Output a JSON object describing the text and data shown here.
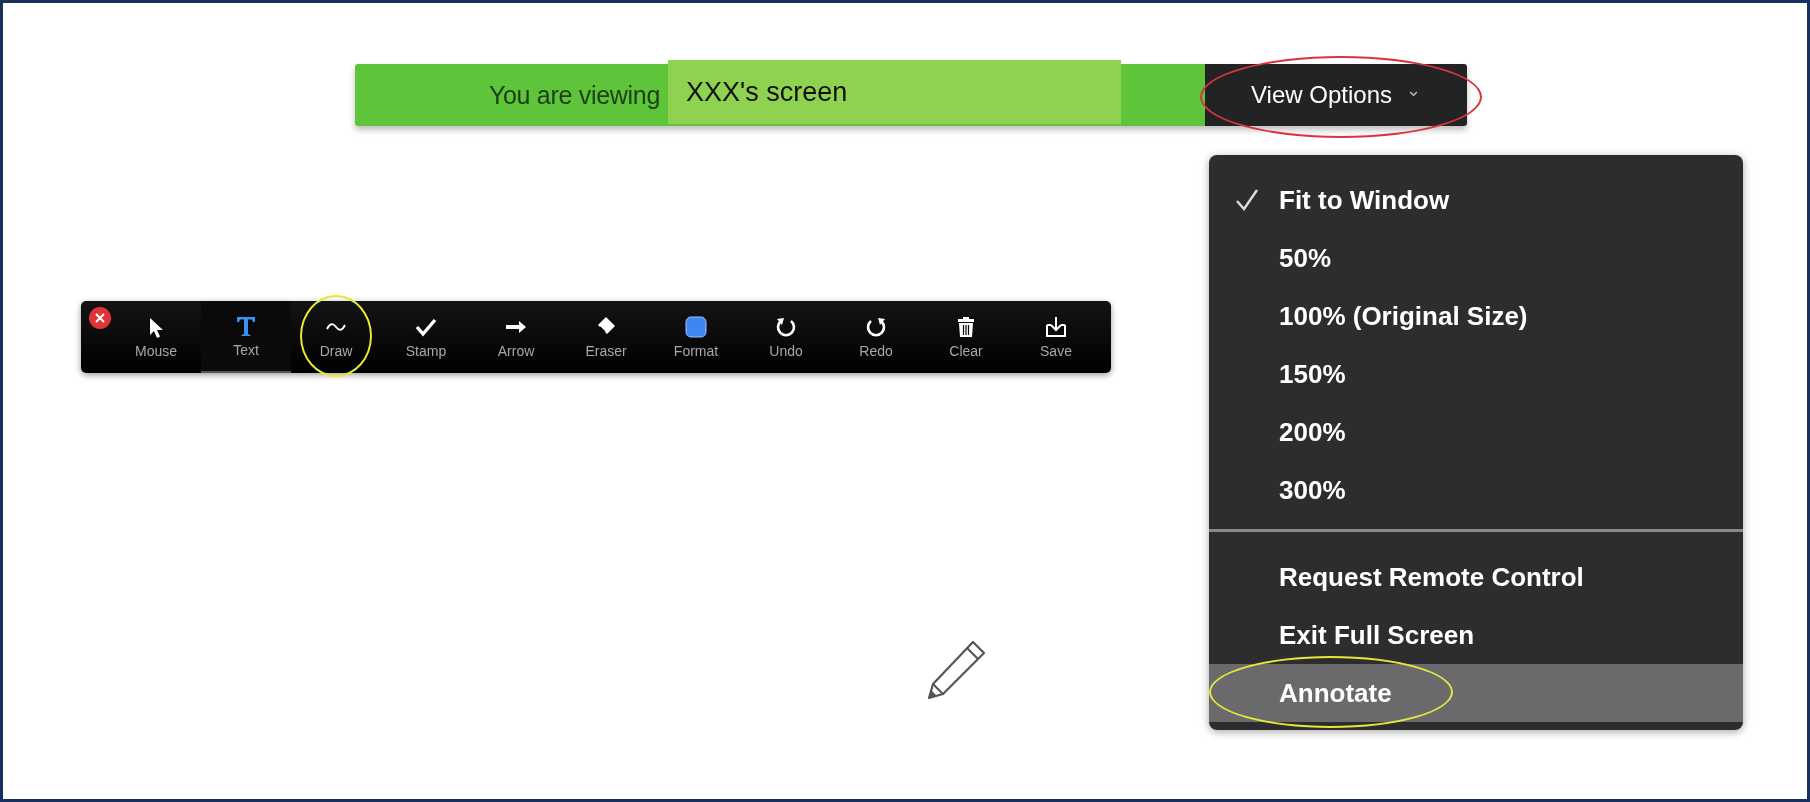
{
  "banner": {
    "prefix": "You are viewing",
    "name": "XXX's screen",
    "button": {
      "label": "View Options",
      "caret": "⌄",
      "circled": true
    }
  },
  "view_menu": {
    "groups": [
      {
        "items": [
          {
            "label": "Fit to Window",
            "checked": true,
            "highlighted": false,
            "circled": false
          },
          {
            "label": "50%",
            "checked": false,
            "highlighted": false,
            "circled": false
          },
          {
            "label": "100% (Original Size)",
            "checked": false,
            "highlighted": false,
            "circled": false
          },
          {
            "label": "150%",
            "checked": false,
            "highlighted": false,
            "circled": false
          },
          {
            "label": "200%",
            "checked": false,
            "highlighted": false,
            "circled": false
          },
          {
            "label": "300%",
            "checked": false,
            "highlighted": false,
            "circled": false
          }
        ]
      },
      {
        "items": [
          {
            "label": "Request Remote Control",
            "checked": false,
            "highlighted": false,
            "circled": false
          },
          {
            "label": "Exit Full Screen",
            "checked": false,
            "highlighted": false,
            "circled": false
          },
          {
            "label": "Annotate",
            "checked": false,
            "highlighted": true,
            "circled": true
          }
        ]
      }
    ]
  },
  "toolbar": {
    "tools": [
      {
        "label": "Mouse",
        "selected": false,
        "circled": false
      },
      {
        "label": "Text",
        "selected": true,
        "circled": false
      },
      {
        "label": "Draw",
        "selected": false,
        "circled": true
      },
      {
        "label": "Stamp",
        "selected": false,
        "circled": false
      },
      {
        "label": "Arrow",
        "selected": false,
        "circled": false
      },
      {
        "label": "Eraser",
        "selected": false,
        "circled": false
      },
      {
        "label": "Format",
        "selected": false,
        "circled": false
      },
      {
        "label": "Undo",
        "selected": false,
        "circled": false
      },
      {
        "label": "Redo",
        "selected": false,
        "circled": false
      },
      {
        "label": "Clear",
        "selected": false,
        "circled": false
      },
      {
        "label": "Save",
        "selected": false,
        "circled": false
      }
    ]
  }
}
